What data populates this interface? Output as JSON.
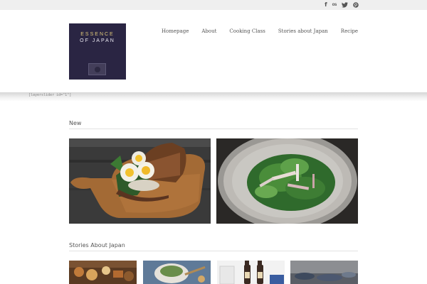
{
  "social": {
    "facebook": "f",
    "lastfm": "os"
  },
  "logo": {
    "line1": "ESSENCE",
    "line2": "OF JAPAN"
  },
  "nav": {
    "items": [
      "Homepage",
      "About",
      "Cooking Class",
      "Stories about Japan",
      "Recipe"
    ]
  },
  "slider_placeholder": "[layerslider id=\"1\"]",
  "sections": {
    "new_title": "New",
    "stories_title": "Stories About Japan"
  },
  "images": {
    "new": [
      "egg-sandwich-photo",
      "herb-salad-photo"
    ],
    "stories": [
      "oden-photo",
      "bowl-dish-photo",
      "sake-bottles-photo",
      "market-photo"
    ]
  },
  "colors": {
    "logo_bg": "#2a2543",
    "logo_gold": "#e0c97a",
    "topbar_bg": "#efefef"
  }
}
